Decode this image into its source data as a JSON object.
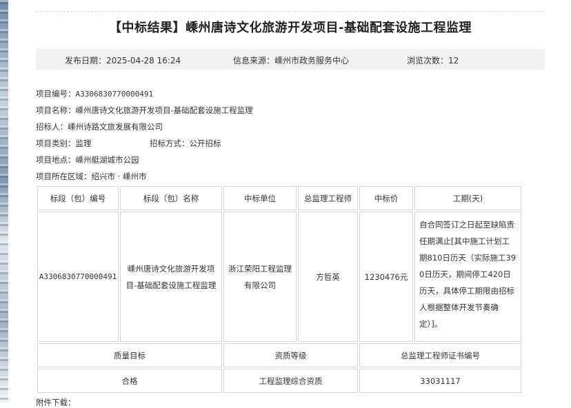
{
  "title": "【中标结果】嵊州唐诗文化旅游开发项目-基础配套设施工程监理",
  "info": {
    "publish_date": "发布日期：2025-04-28 16:24",
    "source": "信息来源：嵊州市政务服务中心",
    "views": "浏览次数：12"
  },
  "fields": {
    "project_no_label": "项目编号：",
    "project_no": "A3306830770000491",
    "project_name_label": "项目名称：",
    "project_name": "嵊州唐诗文化旅游开发项目-基础配套设施工程监理",
    "tenderer_label": "招标人：",
    "tenderer": "嵊州诗路文旅发展有限公司",
    "category_label": "项目类别：",
    "category": "监理",
    "method_label": "招标方式：",
    "method": "公开招标",
    "location_label": "项目地点：",
    "location": "嵊州艇湖城市公园",
    "region_label": "项目所在区域：",
    "region": "绍兴市 · 嵊州市"
  },
  "table": {
    "headers": [
      "标段（包）编号",
      "标段（包）名称",
      "中标单位",
      "总监理工程师",
      "中标价",
      "工期(天)"
    ],
    "row": {
      "section_no": "A3306830770000491",
      "section_name": "嵊州唐诗文化旅游开发项目-基础配套设施工程监理",
      "winner": "浙江荣阳工程监理有限公司",
      "chief_engineer": "方哲英",
      "price": "1230476元",
      "period": "自合同签订之日起至缺陷责任期满止[其中施工计划工期810日历天（实际施工390日历天，期间停工420日历天，具体停工期限由招标人根据整体开发节奏确定）]。"
    },
    "quality_headers": [
      "质量目标",
      "资质等级",
      "总监理工程师证书编号"
    ],
    "quality_row": [
      "合格",
      "工程监理综合资质",
      "33031117"
    ]
  },
  "footer_cut": "附件下载："
}
